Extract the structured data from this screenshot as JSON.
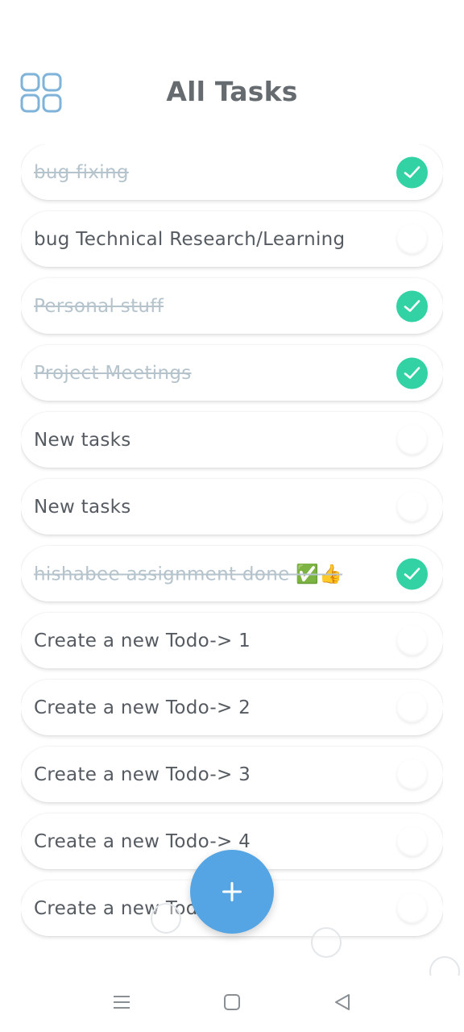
{
  "header": {
    "title": "All Tasks",
    "menu_icon": "grid-icon"
  },
  "colors": {
    "accent": "#55a5e5",
    "done_check": "#33d2a4",
    "done_text": "#b5c4cc",
    "text": "#555b61"
  },
  "tasks": [
    {
      "text": "bug fixing",
      "done": true
    },
    {
      "text": "bug Technical Research/Learning",
      "done": false
    },
    {
      "text": "Personal stuff",
      "done": true
    },
    {
      "text": "Project Meetings",
      "done": true
    },
    {
      "text": "New tasks",
      "done": false
    },
    {
      "text": "New tasks",
      "done": false
    },
    {
      "text": "hishabee assignment done ✅👍",
      "done": true
    },
    {
      "text": "Create a new Todo-> 1",
      "done": false
    },
    {
      "text": "Create a new Todo-> 2",
      "done": false
    },
    {
      "text": "Create a new Todo-> 3",
      "done": false
    },
    {
      "text": "Create a new Todo-> 4",
      "done": false
    },
    {
      "text": "Create a new Todo-> 5",
      "done": false
    }
  ],
  "fab": {
    "icon": "plus-icon"
  },
  "navbar": {
    "icons": [
      "menu-icon",
      "home-square-icon",
      "back-triangle-icon"
    ]
  }
}
